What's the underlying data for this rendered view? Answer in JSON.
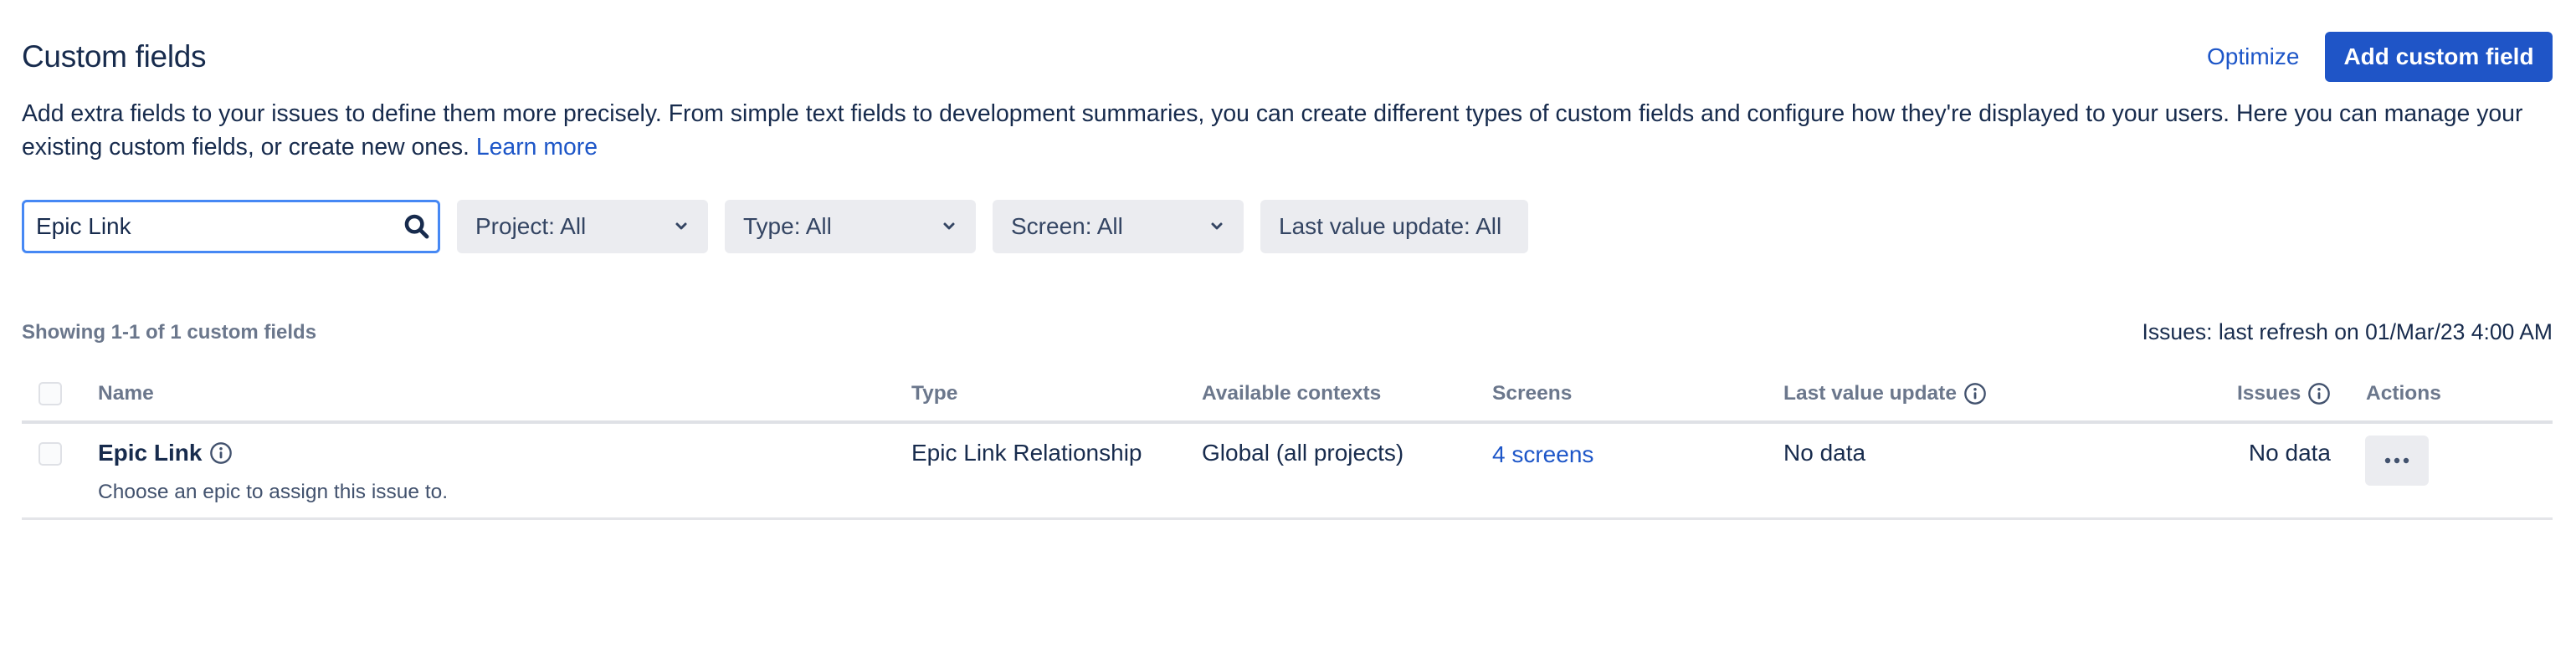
{
  "header": {
    "title": "Custom fields",
    "optimize_label": "Optimize",
    "add_button_label": "Add custom field",
    "description": "Add extra fields to your issues to define them more precisely. From simple text fields to development summaries, you can create different types of custom fields and configure how they're displayed to your users. Here you can manage your existing custom fields, or create new ones.",
    "learn_more_label": "Learn more"
  },
  "filters": {
    "search": {
      "value": "Epic Link",
      "icon": "search-icon"
    },
    "dropdowns": [
      {
        "label": "Project: All",
        "has_chevron": true
      },
      {
        "label": "Type: All",
        "has_chevron": true
      },
      {
        "label": "Screen: All",
        "has_chevron": true
      },
      {
        "label": "Last value update: All",
        "has_chevron": false
      }
    ]
  },
  "table_meta": {
    "showing": "Showing 1-1 of 1 custom fields",
    "refresh": "Issues: last refresh on 01/Mar/23 4:00 AM"
  },
  "table": {
    "columns": {
      "name": "Name",
      "type": "Type",
      "contexts": "Available contexts",
      "screens": "Screens",
      "last_update": "Last value update",
      "issues": "Issues",
      "actions": "Actions"
    },
    "rows": [
      {
        "name": "Epic Link",
        "description": "Choose an epic to assign this issue to.",
        "type": "Epic Link Relationship",
        "contexts": "Global (all projects)",
        "screens": "4 screens",
        "last_update": "No data",
        "issues": "No data",
        "actions_icon": "more-horizontal-icon"
      }
    ]
  },
  "colors": {
    "primary": "#1F55C7",
    "link": "#1D56C8",
    "text": "#172B4D",
    "subtle_text": "#6B778C",
    "focus_border": "#4688F4",
    "neutral_bg": "#EBECF0"
  }
}
